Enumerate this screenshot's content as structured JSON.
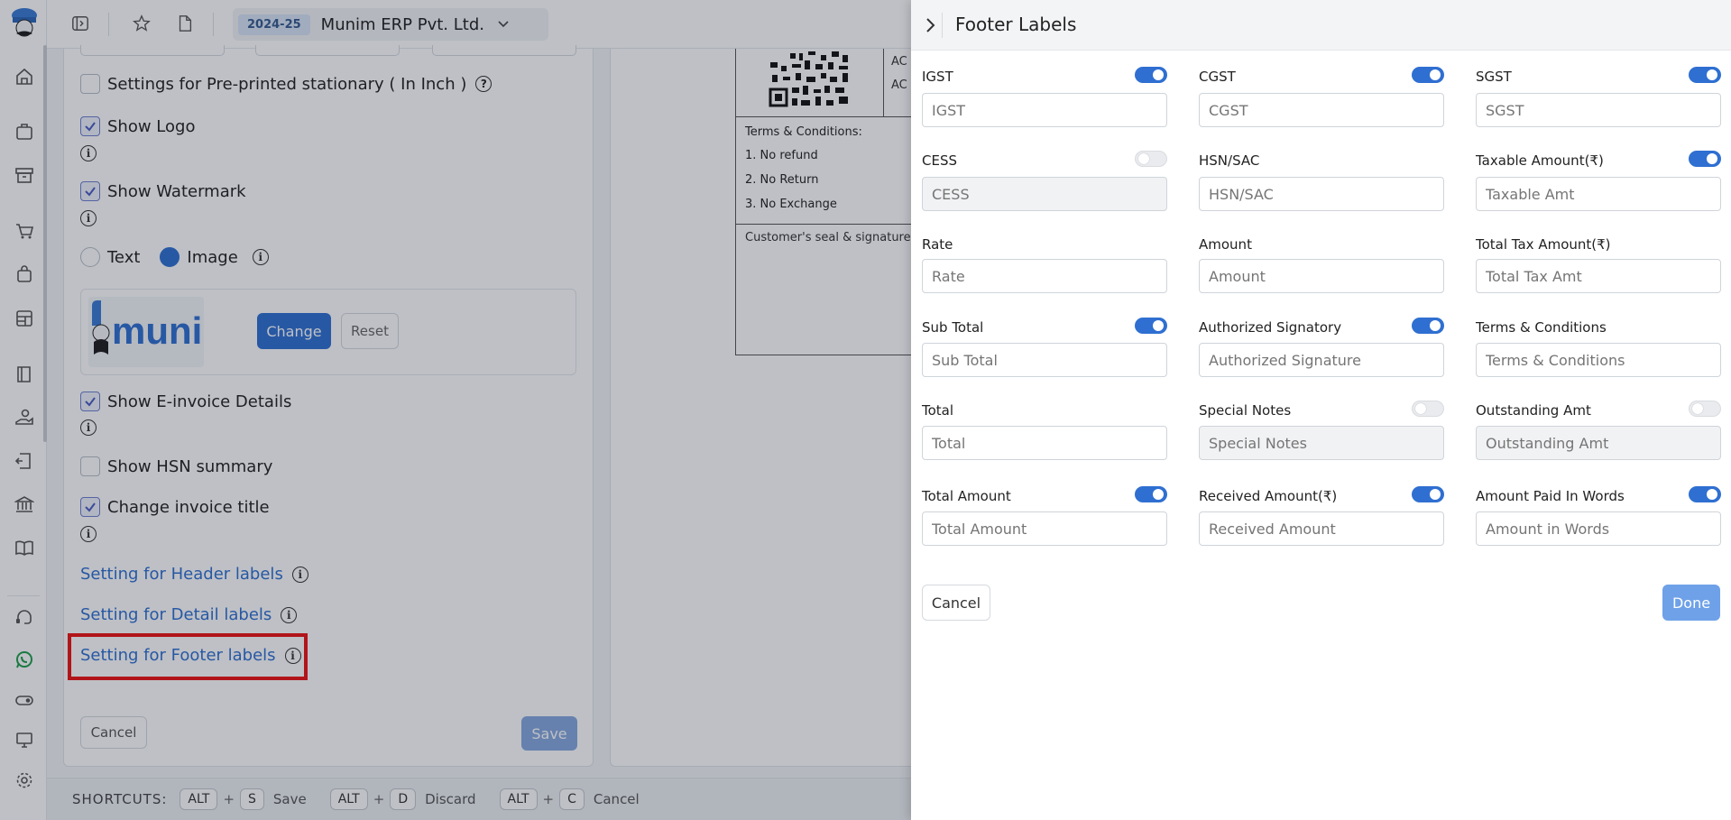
{
  "topbar": {
    "year": "2024-25",
    "company": "Munim ERP Pvt. Ltd."
  },
  "settings": {
    "preprinted_label": "Settings for Pre-printed stationary ( In Inch )",
    "show_logo": "Show Logo",
    "show_watermark": "Show Watermark",
    "watermark_text": "Text",
    "watermark_image": "Image",
    "logo_text": "muni",
    "change_label": "Change",
    "reset_label": "Reset",
    "show_einvoice": "Show E-invoice Details",
    "show_hsn": "Show HSN summary",
    "change_title": "Change invoice title",
    "header_link": "Setting for Header labels",
    "detail_link": "Setting for Detail labels",
    "footer_link": "Setting for Footer labels",
    "cancel_label": "Cancel",
    "save_label": "Save"
  },
  "preview": {
    "ac1": "AC",
    "ac2": "AC",
    "terms_title": "Terms & Conditions:",
    "terms_1": "1. No refund",
    "terms_2": "2. No Return",
    "terms_3": "3. No Exchange",
    "seal": "Customer's seal & signature"
  },
  "shortcuts": {
    "title": "SHORTCUTS:",
    "items": [
      {
        "mod": "ALT",
        "key": "S",
        "action": "Save"
      },
      {
        "mod": "ALT",
        "key": "D",
        "action": "Discard"
      },
      {
        "mod": "ALT",
        "key": "C",
        "action": "Cancel"
      }
    ]
  },
  "drawer": {
    "title": "Footer Labels",
    "cancel_label": "Cancel",
    "done_label": "Done",
    "fields": [
      {
        "label": "IGST",
        "placeholder": "IGST",
        "toggle": "on"
      },
      {
        "label": "CGST",
        "placeholder": "CGST",
        "toggle": "on"
      },
      {
        "label": "SGST",
        "placeholder": "SGST",
        "toggle": "on"
      },
      {
        "label": "CESS",
        "placeholder": "CESS",
        "toggle": "off"
      },
      {
        "label": "HSN/SAC",
        "placeholder": "HSN/SAC",
        "toggle": "none"
      },
      {
        "label": "Taxable Amount(₹)",
        "placeholder": "Taxable Amt",
        "toggle": "on"
      },
      {
        "label": "Rate",
        "placeholder": "Rate",
        "toggle": "none"
      },
      {
        "label": "Amount",
        "placeholder": "Amount",
        "toggle": "none"
      },
      {
        "label": "Total Tax Amount(₹)",
        "placeholder": "Total Tax Amt",
        "toggle": "none"
      },
      {
        "label": "Sub Total",
        "placeholder": "Sub Total",
        "toggle": "on"
      },
      {
        "label": "Authorized Signatory",
        "placeholder": "Authorized Signature",
        "toggle": "on"
      },
      {
        "label": "Terms & Conditions",
        "placeholder": "Terms & Conditions",
        "toggle": "none"
      },
      {
        "label": "Total",
        "placeholder": "Total",
        "toggle": "none"
      },
      {
        "label": "Special Notes",
        "placeholder": "Special Notes",
        "toggle": "off"
      },
      {
        "label": "Outstanding Amt",
        "placeholder": "Outstanding Amt",
        "toggle": "off"
      },
      {
        "label": "Total Amount",
        "placeholder": "Total Amount",
        "toggle": "on"
      },
      {
        "label": "Received Amount(₹)",
        "placeholder": "Received Amount",
        "toggle": "on"
      },
      {
        "label": "Amount Paid In Words",
        "placeholder": "Amount in Words",
        "toggle": "on"
      }
    ]
  },
  "colors": {
    "accent": "#2f6fd1",
    "highlight": "#ee1111"
  }
}
